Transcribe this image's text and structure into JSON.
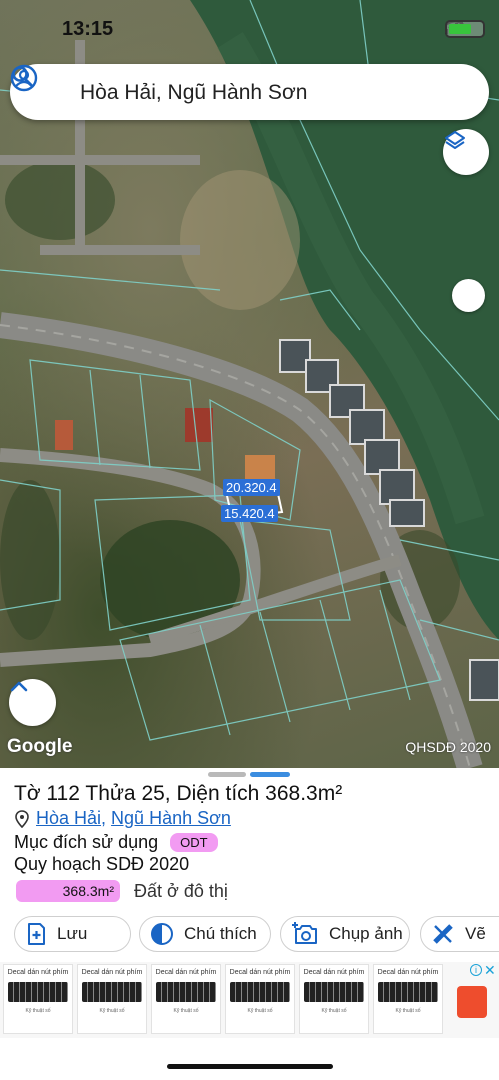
{
  "status_bar": {
    "time": "13:15"
  },
  "search": {
    "query": "Hòa Hải, Ngũ Hành Sơn"
  },
  "map": {
    "logo": "Google",
    "layer_label": "QHSDĐ 2020",
    "measurements": [
      "20.3",
      "20.4",
      "15.4",
      "20.4"
    ]
  },
  "parcel": {
    "title": "Tờ 112 Thửa 25, Diện tích 368.3m²",
    "ward": "Hòa Hải",
    "district": "Ngũ Hành Sơn",
    "separator": ",",
    "purpose_label": "Mục đích sử dụng",
    "purpose_code": "ODT",
    "plan_title": "Quy hoạch SDĐ 2020",
    "plan_area": "368.3m²",
    "plan_desc": "Đất ở đô thị"
  },
  "actions": {
    "save": "Lưu",
    "legend": "Chú thích",
    "photo": "Chụp ảnh",
    "draw": "Vẽ"
  },
  "ads": {
    "title": "Decal dán nút phím",
    "footer": "Kỹ thuật số",
    "info": "i",
    "close": "✕"
  },
  "colors": {
    "accent_blue": "#1a65c4",
    "badge_pink": "#f29bf2",
    "parcel_lines": "#7fd0c8",
    "water": "#2f5a3c"
  },
  "icons": [
    "account-icon",
    "search-icon",
    "layers-icon",
    "chevron-up-icon",
    "location-pin-icon",
    "bookmark-plus-icon",
    "contrast-icon",
    "camera-plus-icon",
    "ruler-icon"
  ]
}
